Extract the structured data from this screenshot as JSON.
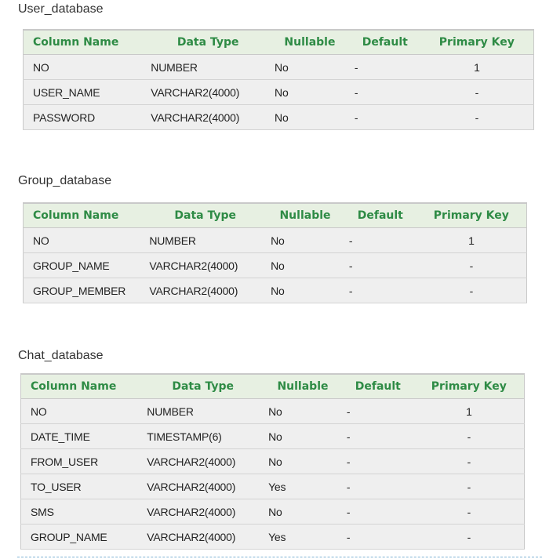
{
  "headers": [
    "Column Name",
    "Data Type",
    "Nullable",
    "Default",
    "Primary Key"
  ],
  "tables": [
    {
      "title": "User_database",
      "rows": [
        [
          "NO",
          "NUMBER",
          "No",
          "-",
          "1"
        ],
        [
          "USER_NAME",
          "VARCHAR2(4000)",
          "No",
          "-",
          "-"
        ],
        [
          "PASSWORD",
          "VARCHAR2(4000)",
          "No",
          "-",
          "-"
        ]
      ]
    },
    {
      "title": "Group_database",
      "rows": [
        [
          "NO",
          "NUMBER",
          "No",
          "-",
          "1"
        ],
        [
          "GROUP_NAME",
          "VARCHAR2(4000)",
          "No",
          "-",
          "-"
        ],
        [
          "GROUP_MEMBER",
          "VARCHAR2(4000)",
          "No",
          "-",
          "-"
        ]
      ]
    },
    {
      "title": "Chat_database",
      "rows": [
        [
          "NO",
          "NUMBER",
          "No",
          "-",
          "1"
        ],
        [
          "DATE_TIME",
          "TIMESTAMP(6)",
          "No",
          "-",
          "-"
        ],
        [
          "FROM_USER",
          "VARCHAR2(4000)",
          "No",
          "-",
          "-"
        ],
        [
          "TO_USER",
          "VARCHAR2(4000)",
          "Yes",
          "-",
          "-"
        ],
        [
          "SMS",
          "VARCHAR2(4000)",
          "No",
          "-",
          "-"
        ],
        [
          "GROUP_NAME",
          "VARCHAR2(4000)",
          "Yes",
          "-",
          "-"
        ]
      ]
    }
  ]
}
